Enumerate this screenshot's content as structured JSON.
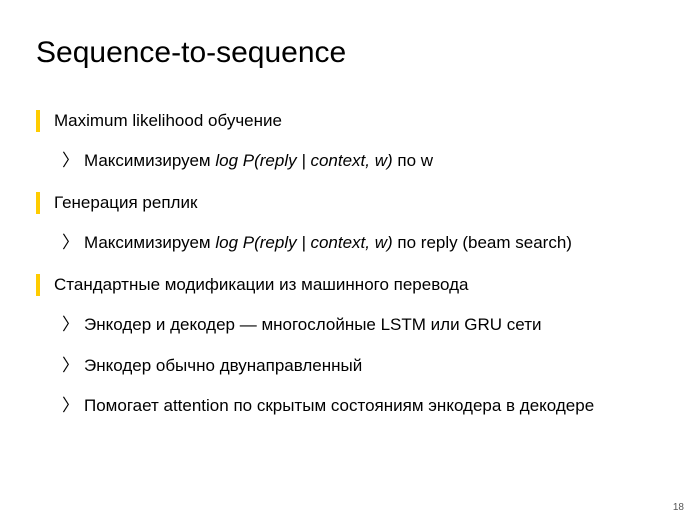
{
  "slide": {
    "title": "Sequence-to-sequence",
    "page_number": "18",
    "items": [
      {
        "label": "Maximum likelihood обучение",
        "subs": [
          {
            "prefix": "Максимизируем ",
            "formula": "log P(reply | context, w)",
            "suffix": " по w"
          }
        ]
      },
      {
        "label": "Генерация реплик",
        "subs": [
          {
            "prefix": "Максимизируем ",
            "formula": "log P(reply | context, w)",
            "suffix": " по reply (beam search)"
          }
        ]
      },
      {
        "label": "Стандартные модификации из машинного перевода",
        "subs": [
          {
            "prefix": "Энкодер и декодер — многослойные LSTM или GRU сети",
            "formula": "",
            "suffix": ""
          },
          {
            "prefix": "Энкодер обычно двунаправленный",
            "formula": "",
            "suffix": ""
          },
          {
            "prefix": "Помогает attention по скрытым состояниям энкодера в декодере",
            "formula": "",
            "suffix": ""
          }
        ]
      }
    ]
  }
}
